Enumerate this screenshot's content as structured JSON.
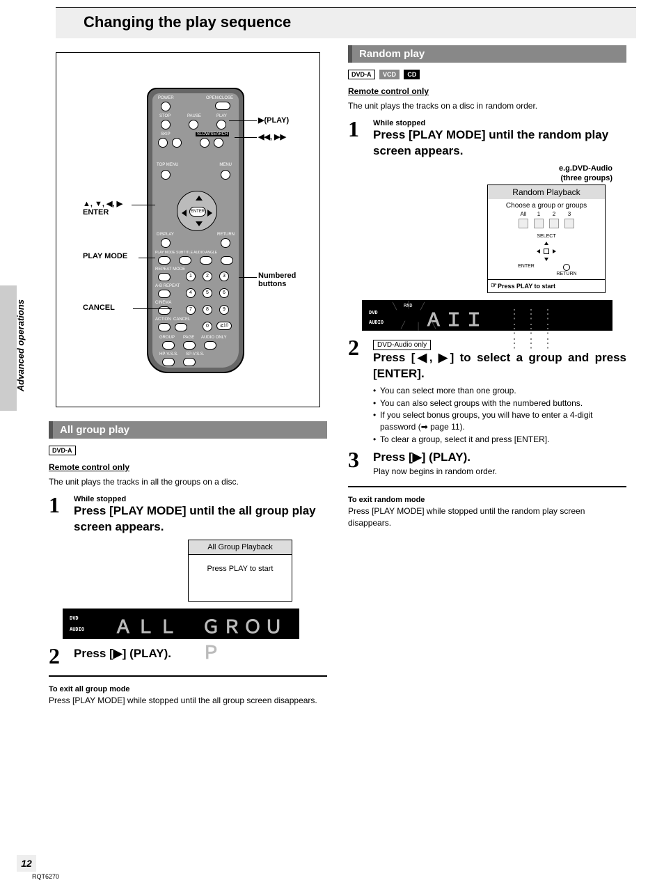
{
  "page": {
    "title": "Changing the play sequence",
    "side_label": "Advanced operations",
    "page_number": "12",
    "doc_code": "RQT6270"
  },
  "remote": {
    "callouts": {
      "play": "▶(PLAY)",
      "skip": "◀◀, ▶▶",
      "dpad": "▲, ▼, ◀, ▶\nENTER",
      "playmode": "PLAY MODE",
      "cancel": "CANCEL",
      "numbered": "Numbered\nbuttons"
    },
    "internal_labels": {
      "power": "POWER",
      "openclose": "OPEN/CLOSE",
      "stop": "STOP",
      "pause": "PAUSE",
      "play": "PLAY",
      "skip": "SKIP",
      "slowsearch": "SLOW/SEARCH",
      "topmenu": "TOP MENU",
      "menu": "MENU",
      "enter": "ENTER",
      "display": "DISPLAY",
      "return": "RETURN",
      "row1": "PLAY MODE SUBTITLE AUDIO ANGLE",
      "repeat": "REPEAT MODE",
      "abrepeat": "A-B REPEAT",
      "cinema": "CINEMA",
      "action": "ACTION",
      "cancel": "CANCEL",
      "group": "GROUP",
      "page": "PAGE",
      "audioonly": "AUDIO ONLY",
      "hpvss": "HP-V.S.S.",
      "spvss": "SP-V.S.S."
    }
  },
  "left": {
    "header": "All group  play",
    "badge": "DVD-A",
    "remote_only": "Remote control only",
    "intro": "The unit plays the tracks in all the groups on a disc.",
    "step1": {
      "pre": "While stopped",
      "main": "Press [PLAY MODE] until the all group play screen appears."
    },
    "osd": {
      "title": "All Group Playback",
      "body": "Press PLAY to start"
    },
    "display": {
      "left": "DVD",
      "left2": "AUDIO",
      "seg": "ALL  GROUP"
    },
    "step2": {
      "main": "Press [▶] (PLAY)."
    },
    "exit_title": "To exit all group mode",
    "exit_body": "Press [PLAY MODE] while stopped until the all group screen disappears."
  },
  "right": {
    "header": "Random play",
    "badges": [
      "DVD-A",
      "VCD",
      "CD"
    ],
    "remote_only": "Remote control only",
    "intro": "The unit plays the tracks on a disc in random order.",
    "step1": {
      "pre": "While stopped",
      "main": "Press [PLAY MODE] until the random play screen appears."
    },
    "eg": "e.g.DVD-Audio\n(three groups)",
    "rp": {
      "hd": "Random Playback",
      "ch": "Choose  a group or groups",
      "groups": [
        "All",
        "1",
        "2",
        "3"
      ],
      "select": "SELECT",
      "enter": "ENTER",
      "return": "RETURN",
      "ft": "Press PLAY to start"
    },
    "display": {
      "left": "DVD",
      "left2": "AUDIO",
      "rnd": "RND",
      "seg": "A I I"
    },
    "step2": {
      "tag": "DVD-Audio only",
      "main": "Press [◀, ▶]  to select a group and press [ENTER].",
      "bullets": [
        "You can select more than one group.",
        "You can also select groups with the numbered buttons.",
        "If you select bonus groups, you will have to enter a 4-digit password (➡ page 11).",
        "To clear a group, select it and press [ENTER]."
      ]
    },
    "step3": {
      "main": "Press [▶] (PLAY).",
      "sub": "Play now begins in random order."
    },
    "exit_title": "To exit random mode",
    "exit_body": "Press [PLAY MODE] while stopped until the random play screen disappears."
  }
}
